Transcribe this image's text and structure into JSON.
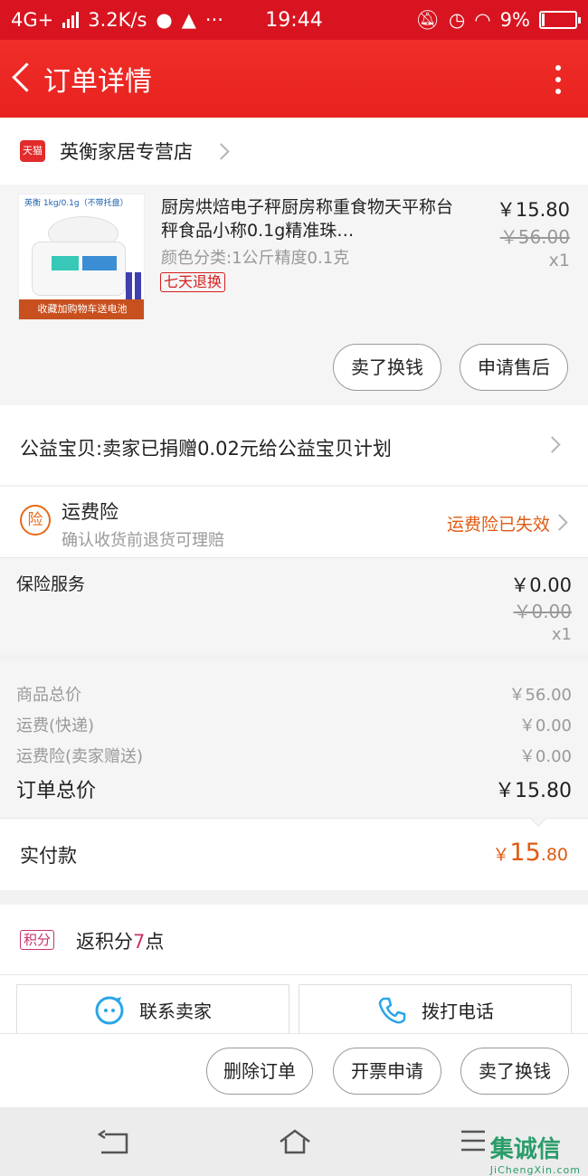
{
  "status_bar": {
    "network": "4G+",
    "speed": "3.2K/s",
    "time": "19:44",
    "battery": "9%",
    "battery_level": 0.09
  },
  "header": {
    "title": "订单详情"
  },
  "store": {
    "badge": "天猫",
    "name": "英衡家居专营店"
  },
  "product": {
    "image_brand": "英衡",
    "image_caption": "1kg/0.1g（不带托盘）",
    "image_banner": "收藏加购物车送电池",
    "title": "厨房烘焙电子秤厨房称重食物天平称台秤食品小称0.1g精准珠…",
    "spec": "颜色分类:1公斤精度0.1克",
    "tag": "七天退换",
    "price": "￥15.80",
    "original_price": "￥56.00",
    "quantity": "x1",
    "buttons": [
      "卖了换钱",
      "申请售后"
    ]
  },
  "charity": {
    "text": "公益宝贝:卖家已捐赠0.02元给公益宝贝计划"
  },
  "freight_insurance": {
    "icon_text": "险",
    "title": "运费险",
    "subtitle": "确认收货前退货可理赔",
    "status": "运费险已失效"
  },
  "insurance_service": {
    "label": "保险服务",
    "price": "￥0.00",
    "original_price": "￥0.00",
    "quantity": "x1"
  },
  "totals": {
    "rows": [
      {
        "label": "商品总价",
        "value": "￥56.00"
      },
      {
        "label": "运费(快递)",
        "value": "￥0.00"
      },
      {
        "label": "运费险(卖家赠送)",
        "value": "￥0.00"
      }
    ],
    "order_total_label": "订单总价",
    "order_total_value": "￥15.80"
  },
  "paid": {
    "label": "实付款",
    "currency": "￥",
    "amount_int": "15",
    "amount_dec": ".80"
  },
  "points": {
    "badge": "积分",
    "prefix": "返积分",
    "number": "7",
    "suffix": "点"
  },
  "contact": {
    "seller": "联系卖家",
    "phone": "拨打电话"
  },
  "actions": {
    "delete": "删除订单",
    "invoice": "开票申请",
    "resell": "卖了换钱"
  },
  "watermark": {
    "text": "集诚信",
    "domain": "JiChengXin.com"
  },
  "colors": {
    "header_red": "#e8221f",
    "accent_orange": "#e05a12",
    "points_purple": "#c9316e"
  }
}
